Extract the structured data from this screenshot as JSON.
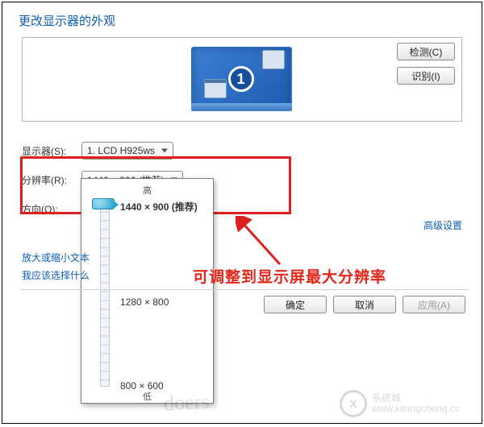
{
  "title": "更改显示器的外观",
  "monitor": {
    "number": "1"
  },
  "buttons": {
    "detect": "检测(C)",
    "identify": "识别(I)",
    "ok": "确定",
    "cancel": "取消",
    "apply": "应用(A)"
  },
  "labels": {
    "display": "显示器(S):",
    "resolution": "分辨率(R):",
    "orientation": "方向(O):"
  },
  "selects": {
    "display_value": "1. LCD H925ws",
    "resolution_value": "1440 × 900 (推荐)"
  },
  "slider": {
    "high": "高",
    "low": "低",
    "recommended": "1440 × 900 (推荐)",
    "mid": "1280 × 800",
    "min": "800 × 600"
  },
  "links": {
    "advanced": "高级设置",
    "text_size": "放大或缩小文本",
    "which_setting": "我应该选择什么"
  },
  "annotation": "可调整到显示屏最大分辨率",
  "watermark": {
    "brand": "系统城",
    "url": "www.xitongcheng.cc"
  },
  "signature": "doers"
}
